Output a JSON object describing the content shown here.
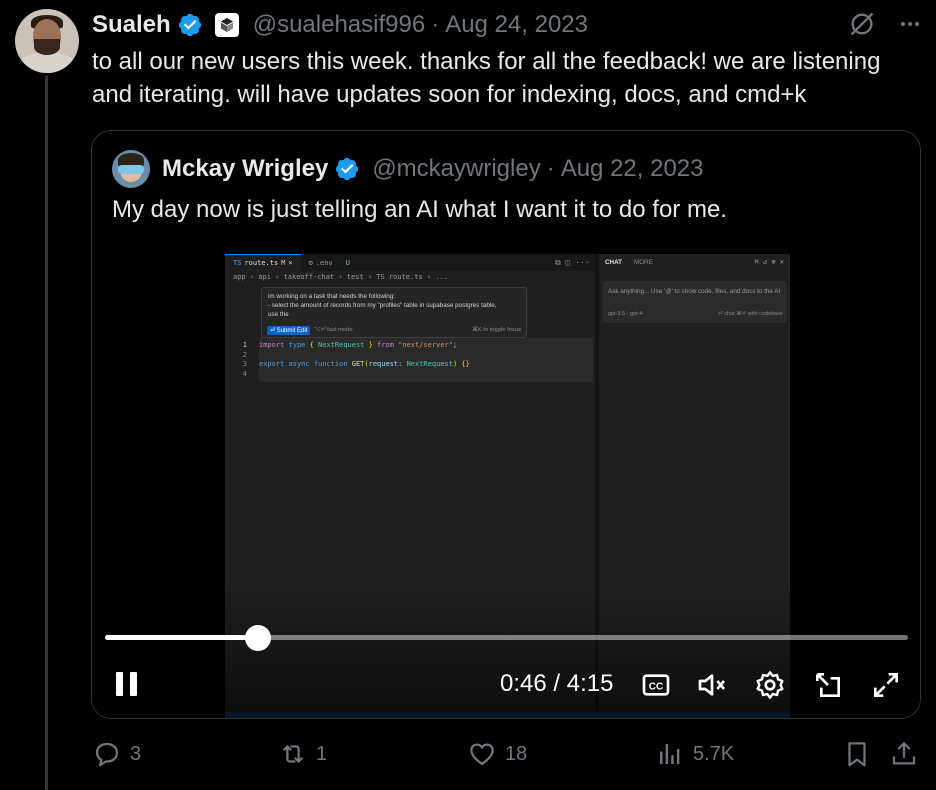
{
  "author": {
    "name": "Sualeh",
    "handle": "@sualehasif996",
    "separator": "·",
    "date": "Aug 24, 2023"
  },
  "tweet": {
    "text": "to all our new users this week. thanks for all the feedback! we are listening and iterating. will have updates soon for indexing, docs, and cmd+k"
  },
  "quote": {
    "name": "Mckay Wrigley",
    "handle": "@mckaywrigley",
    "separator": "·",
    "date": "Aug 22, 2023",
    "text": "My day now is just telling an AI what I want it to do for me."
  },
  "video": {
    "current_time": "0:46",
    "duration": "4:15",
    "time_display": "0:46 / 4:15",
    "progress_fraction": 0.19,
    "editor": {
      "tabs": [
        {
          "lang": "TS",
          "name": "route.ts",
          "status": "M"
        },
        {
          "lang": "⚙",
          "name": ".env",
          "status": "U"
        }
      ],
      "breadcrumb": "app › api › takeoff-chat › test › TS route.ts › ...",
      "prompt_lines": [
        "im working on a task that needs the following:",
        "- select the amount of records from my \"profiles\" table in supabase postgres table,",
        "use the"
      ],
      "submit_label": "⏎ Submit Edit",
      "fast_mode": "⌥⏎ fast mode",
      "toggle_focus": "⌘K to toggle focus",
      "line_numbers": [
        "1",
        "2",
        "3",
        "4"
      ],
      "chat_tab": "CHAT",
      "more_tab": "MORE",
      "chat_placeholder": "Ask anything... Use '@' to show code, files, and docs to the AI",
      "chat_model": "gpt-3.5 · gpt-4",
      "chat_send": "⏎ chat   ⌘⏎ with codebase"
    }
  },
  "actions": {
    "replies": "3",
    "reposts": "1",
    "likes": "18",
    "views": "5.7K"
  },
  "colors": {
    "background": "#000000",
    "text": "#e7e9ea",
    "muted": "#71767b",
    "verified": "#1d9bf0",
    "border": "#2f3336"
  }
}
